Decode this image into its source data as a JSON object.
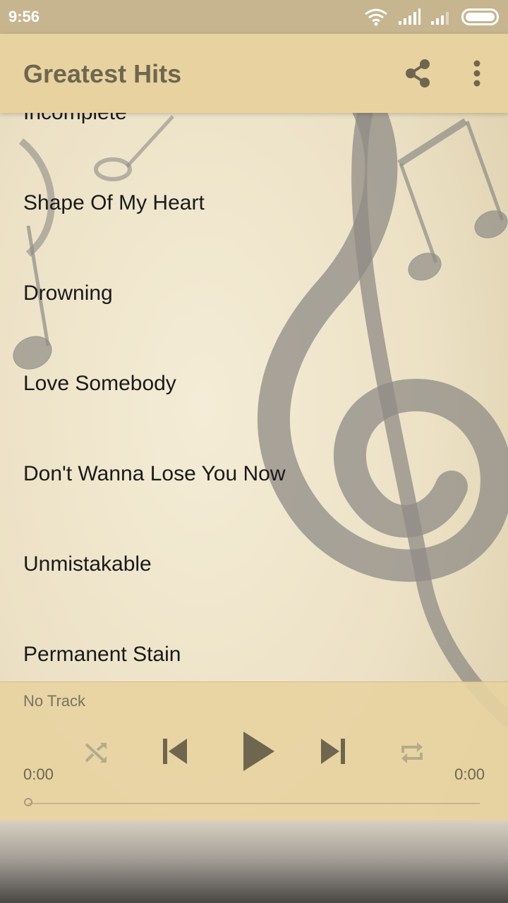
{
  "status_bar": {
    "time": "9:56"
  },
  "app_bar": {
    "title": "Greatest Hits"
  },
  "tracks": [
    {
      "title": "Incomplete"
    },
    {
      "title": "Shape Of My Heart"
    },
    {
      "title": "Drowning"
    },
    {
      "title": "Love Somebody"
    },
    {
      "title": "Don't Wanna Lose You Now"
    },
    {
      "title": "Unmistakable"
    },
    {
      "title": "Permanent Stain"
    }
  ],
  "player": {
    "now_playing": "No Track",
    "elapsed": "0:00",
    "duration": "0:00",
    "progress_fraction": 0
  },
  "colors": {
    "app_bar": "#e8d3a0",
    "status_bar": "#c6b58f",
    "accent_text": "#6f6650"
  }
}
